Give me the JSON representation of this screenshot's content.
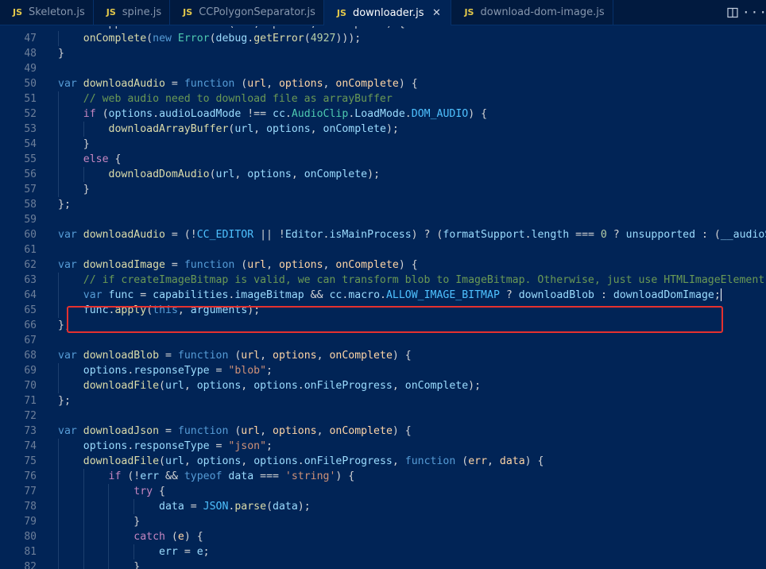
{
  "tabs": [
    {
      "icon": "JS",
      "label": "Skeleton.js",
      "active": false
    },
    {
      "icon": "JS",
      "label": "spine.js",
      "active": false
    },
    {
      "icon": "JS",
      "label": "CCPolygonSeparator.js",
      "active": false
    },
    {
      "icon": "JS",
      "label": "downloader.js",
      "active": true,
      "close": "✕"
    },
    {
      "icon": "JS",
      "label": "download-dom-image.js",
      "active": false
    }
  ],
  "more_glyph": "···",
  "colors": {
    "background": "#012456",
    "highlight_border": "#e5312f",
    "js_icon": "#e3c84b"
  },
  "lines": [
    {
      "num": "47",
      "indent": 1,
      "tokens": [
        [
          "o",
          "    "
        ],
        [
          "f",
          "onComplete"
        ],
        [
          "o",
          "("
        ],
        [
          "k",
          "new "
        ],
        [
          "cl",
          "Error"
        ],
        [
          "o",
          "("
        ],
        [
          "v",
          "debug"
        ],
        [
          "o",
          "."
        ],
        [
          "f",
          "getError"
        ],
        [
          "o",
          "("
        ],
        [
          "n",
          "4927"
        ],
        [
          "o",
          ")));"
        ]
      ]
    },
    {
      "num": "48",
      "indent": 0,
      "tokens": [
        [
          "o",
          "}"
        ]
      ]
    },
    {
      "num": "49",
      "indent": 0,
      "tokens": []
    },
    {
      "num": "50",
      "indent": 0,
      "tokens": [
        [
          "k",
          "var "
        ],
        [
          "f",
          "downloadAudio"
        ],
        [
          "o",
          " = "
        ],
        [
          "k",
          "function "
        ],
        [
          "o",
          "("
        ],
        [
          "p",
          "url"
        ],
        [
          "o",
          ", "
        ],
        [
          "p",
          "options"
        ],
        [
          "o",
          ", "
        ],
        [
          "p",
          "onComplete"
        ],
        [
          "o",
          ") {"
        ]
      ]
    },
    {
      "num": "51",
      "indent": 1,
      "tokens": [
        [
          "o",
          "    "
        ],
        [
          "c",
          "// web audio need to download file as arrayBuffer"
        ]
      ]
    },
    {
      "num": "52",
      "indent": 1,
      "tokens": [
        [
          "o",
          "    "
        ],
        [
          "kc",
          "if "
        ],
        [
          "o",
          "("
        ],
        [
          "v",
          "options"
        ],
        [
          "o",
          "."
        ],
        [
          "v",
          "audioLoadMode"
        ],
        [
          "o",
          " !== "
        ],
        [
          "v",
          "cc"
        ],
        [
          "o",
          "."
        ],
        [
          "cl",
          "AudioClip"
        ],
        [
          "o",
          "."
        ],
        [
          "v",
          "LoadMode"
        ],
        [
          "o",
          "."
        ],
        [
          "cn",
          "DOM_AUDIO"
        ],
        [
          "o",
          ") {"
        ]
      ]
    },
    {
      "num": "53",
      "indent": 2,
      "tokens": [
        [
          "o",
          "        "
        ],
        [
          "f",
          "downloadArrayBuffer"
        ],
        [
          "o",
          "("
        ],
        [
          "v",
          "url"
        ],
        [
          "o",
          ", "
        ],
        [
          "v",
          "options"
        ],
        [
          "o",
          ", "
        ],
        [
          "v",
          "onComplete"
        ],
        [
          "o",
          ");"
        ]
      ]
    },
    {
      "num": "54",
      "indent": 1,
      "tokens": [
        [
          "o",
          "    }"
        ]
      ]
    },
    {
      "num": "55",
      "indent": 1,
      "tokens": [
        [
          "o",
          "    "
        ],
        [
          "kc",
          "else "
        ],
        [
          "o",
          "{"
        ]
      ]
    },
    {
      "num": "56",
      "indent": 2,
      "tokens": [
        [
          "o",
          "        "
        ],
        [
          "f",
          "downloadDomAudio"
        ],
        [
          "o",
          "("
        ],
        [
          "v",
          "url"
        ],
        [
          "o",
          ", "
        ],
        [
          "v",
          "options"
        ],
        [
          "o",
          ", "
        ],
        [
          "v",
          "onComplete"
        ],
        [
          "o",
          ");"
        ]
      ]
    },
    {
      "num": "57",
      "indent": 1,
      "tokens": [
        [
          "o",
          "    }"
        ]
      ]
    },
    {
      "num": "58",
      "indent": 0,
      "tokens": [
        [
          "o",
          "};"
        ]
      ]
    },
    {
      "num": "59",
      "indent": 0,
      "tokens": []
    },
    {
      "num": "60",
      "indent": 0,
      "tokens": [
        [
          "k",
          "var "
        ],
        [
          "f",
          "downloadAudio"
        ],
        [
          "o",
          " = (!"
        ],
        [
          "cn",
          "CC_EDITOR"
        ],
        [
          "o",
          " || !"
        ],
        [
          "v",
          "Editor"
        ],
        [
          "o",
          "."
        ],
        [
          "v",
          "isMainProcess"
        ],
        [
          "o",
          ") ? ("
        ],
        [
          "v",
          "formatSupport"
        ],
        [
          "o",
          "."
        ],
        [
          "v",
          "length"
        ],
        [
          "o",
          " === "
        ],
        [
          "n",
          "0"
        ],
        [
          "o",
          " ? "
        ],
        [
          "v",
          "unsupported"
        ],
        [
          "o",
          " : ("
        ],
        [
          "v",
          "__audioSupp"
        ]
      ]
    },
    {
      "num": "61",
      "indent": 0,
      "tokens": []
    },
    {
      "num": "62",
      "indent": 0,
      "tokens": [
        [
          "k",
          "var "
        ],
        [
          "f",
          "downloadImage"
        ],
        [
          "o",
          " = "
        ],
        [
          "k",
          "function "
        ],
        [
          "o",
          "("
        ],
        [
          "p",
          "url"
        ],
        [
          "o",
          ", "
        ],
        [
          "p",
          "options"
        ],
        [
          "o",
          ", "
        ],
        [
          "p",
          "onComplete"
        ],
        [
          "o",
          ") {"
        ]
      ]
    },
    {
      "num": "63",
      "indent": 1,
      "tokens": [
        [
          "o",
          "    "
        ],
        [
          "c",
          "// if createImageBitmap is valid, we can transform blob to ImageBitmap. Otherwise, just use HTMLImageElement to"
        ]
      ]
    },
    {
      "num": "64",
      "indent": 1,
      "cursor": true,
      "tokens": [
        [
          "o",
          "    "
        ],
        [
          "k",
          "var "
        ],
        [
          "v",
          "func"
        ],
        [
          "o",
          " = "
        ],
        [
          "v",
          "capabilities"
        ],
        [
          "o",
          "."
        ],
        [
          "v",
          "imageBitmap"
        ],
        [
          "o",
          " && "
        ],
        [
          "v",
          "cc"
        ],
        [
          "o",
          "."
        ],
        [
          "v",
          "macro"
        ],
        [
          "o",
          "."
        ],
        [
          "cn",
          "ALLOW_IMAGE_BITMAP"
        ],
        [
          "o",
          " ? "
        ],
        [
          "v",
          "downloadBlob"
        ],
        [
          "o",
          " : "
        ],
        [
          "v",
          "downloadDomImage"
        ],
        [
          "o",
          ";"
        ]
      ]
    },
    {
      "num": "65",
      "indent": 1,
      "tokens": [
        [
          "o",
          "    "
        ],
        [
          "v",
          "func"
        ],
        [
          "o",
          "."
        ],
        [
          "f",
          "apply"
        ],
        [
          "o",
          "("
        ],
        [
          "k",
          "this"
        ],
        [
          "o",
          ", "
        ],
        [
          "v",
          "arguments"
        ],
        [
          "o",
          ");"
        ]
      ]
    },
    {
      "num": "66",
      "indent": 0,
      "tokens": [
        [
          "o",
          "};"
        ]
      ]
    },
    {
      "num": "67",
      "indent": 0,
      "tokens": []
    },
    {
      "num": "68",
      "indent": 0,
      "tokens": [
        [
          "k",
          "var "
        ],
        [
          "f",
          "downloadBlob"
        ],
        [
          "o",
          " = "
        ],
        [
          "k",
          "function "
        ],
        [
          "o",
          "("
        ],
        [
          "p",
          "url"
        ],
        [
          "o",
          ", "
        ],
        [
          "p",
          "options"
        ],
        [
          "o",
          ", "
        ],
        [
          "p",
          "onComplete"
        ],
        [
          "o",
          ") {"
        ]
      ]
    },
    {
      "num": "69",
      "indent": 1,
      "tokens": [
        [
          "o",
          "    "
        ],
        [
          "v",
          "options"
        ],
        [
          "o",
          "."
        ],
        [
          "v",
          "responseType"
        ],
        [
          "o",
          " = "
        ],
        [
          "s",
          "\"blob\""
        ],
        [
          "o",
          ";"
        ]
      ]
    },
    {
      "num": "70",
      "indent": 1,
      "tokens": [
        [
          "o",
          "    "
        ],
        [
          "f",
          "downloadFile"
        ],
        [
          "o",
          "("
        ],
        [
          "v",
          "url"
        ],
        [
          "o",
          ", "
        ],
        [
          "v",
          "options"
        ],
        [
          "o",
          ", "
        ],
        [
          "v",
          "options"
        ],
        [
          "o",
          "."
        ],
        [
          "v",
          "onFileProgress"
        ],
        [
          "o",
          ", "
        ],
        [
          "v",
          "onComplete"
        ],
        [
          "o",
          ");"
        ]
      ]
    },
    {
      "num": "71",
      "indent": 0,
      "tokens": [
        [
          "o",
          "};"
        ]
      ]
    },
    {
      "num": "72",
      "indent": 0,
      "tokens": []
    },
    {
      "num": "73",
      "indent": 0,
      "tokens": [
        [
          "k",
          "var "
        ],
        [
          "f",
          "downloadJson"
        ],
        [
          "o",
          " = "
        ],
        [
          "k",
          "function "
        ],
        [
          "o",
          "("
        ],
        [
          "p",
          "url"
        ],
        [
          "o",
          ", "
        ],
        [
          "p",
          "options"
        ],
        [
          "o",
          ", "
        ],
        [
          "p",
          "onComplete"
        ],
        [
          "o",
          ") {"
        ]
      ]
    },
    {
      "num": "74",
      "indent": 1,
      "tokens": [
        [
          "o",
          "    "
        ],
        [
          "v",
          "options"
        ],
        [
          "o",
          "."
        ],
        [
          "v",
          "responseType"
        ],
        [
          "o",
          " = "
        ],
        [
          "s",
          "\"json\""
        ],
        [
          "o",
          ";"
        ]
      ]
    },
    {
      "num": "75",
      "indent": 1,
      "tokens": [
        [
          "o",
          "    "
        ],
        [
          "f",
          "downloadFile"
        ],
        [
          "o",
          "("
        ],
        [
          "v",
          "url"
        ],
        [
          "o",
          ", "
        ],
        [
          "v",
          "options"
        ],
        [
          "o",
          ", "
        ],
        [
          "v",
          "options"
        ],
        [
          "o",
          "."
        ],
        [
          "v",
          "onFileProgress"
        ],
        [
          "o",
          ", "
        ],
        [
          "k",
          "function "
        ],
        [
          "o",
          "("
        ],
        [
          "p",
          "err"
        ],
        [
          "o",
          ", "
        ],
        [
          "p",
          "data"
        ],
        [
          "o",
          ") {"
        ]
      ]
    },
    {
      "num": "76",
      "indent": 2,
      "tokens": [
        [
          "o",
          "        "
        ],
        [
          "kc",
          "if "
        ],
        [
          "o",
          "(!"
        ],
        [
          "v",
          "err"
        ],
        [
          "o",
          " && "
        ],
        [
          "k",
          "typeof "
        ],
        [
          "v",
          "data"
        ],
        [
          "o",
          " === "
        ],
        [
          "s",
          "'string'"
        ],
        [
          "o",
          ") {"
        ]
      ]
    },
    {
      "num": "77",
      "indent": 3,
      "tokens": [
        [
          "o",
          "            "
        ],
        [
          "kc",
          "try "
        ],
        [
          "o",
          "{"
        ]
      ]
    },
    {
      "num": "78",
      "indent": 4,
      "tokens": [
        [
          "o",
          "                "
        ],
        [
          "v",
          "data"
        ],
        [
          "o",
          " = "
        ],
        [
          "cn",
          "JSON"
        ],
        [
          "o",
          "."
        ],
        [
          "f",
          "parse"
        ],
        [
          "o",
          "("
        ],
        [
          "v",
          "data"
        ],
        [
          "o",
          ");"
        ]
      ]
    },
    {
      "num": "79",
      "indent": 3,
      "tokens": [
        [
          "o",
          "            }"
        ]
      ]
    },
    {
      "num": "80",
      "indent": 3,
      "tokens": [
        [
          "o",
          "            "
        ],
        [
          "kc",
          "catch "
        ],
        [
          "o",
          "("
        ],
        [
          "p",
          "e"
        ],
        [
          "o",
          ") {"
        ]
      ]
    },
    {
      "num": "81",
      "indent": 4,
      "tokens": [
        [
          "o",
          "                "
        ],
        [
          "v",
          "err"
        ],
        [
          "o",
          " = "
        ],
        [
          "v",
          "e"
        ],
        [
          "o",
          ";"
        ]
      ]
    },
    {
      "num": "82",
      "indent": 3,
      "tokens": [
        [
          "o",
          "            }"
        ]
      ]
    }
  ],
  "partial_top_line": {
    "num": "46",
    "text": "var unsupported = function (url, options, onComplete) {"
  }
}
